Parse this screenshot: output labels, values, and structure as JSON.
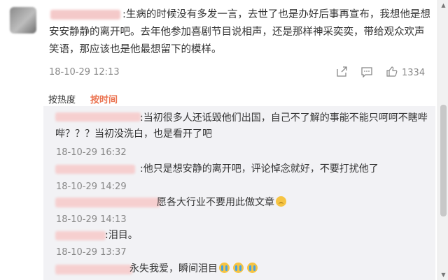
{
  "comment": {
    "text": ":生病的时候没有多发一言，去世了也是办好后事再宣布，我想他是想安安静静的离开吧。去年他参加喜剧节目说相声，还是那样神采奕奕，带给观众欢声笑语，那应该也是他最想留下的模样。",
    "time": "18-10-29 12:13",
    "like_count": "1334"
  },
  "sort": {
    "hot": "按热度",
    "time": "按时间"
  },
  "replies": [
    {
      "text": ":当初很多人还诋毁他们出国，自己不了解的事能不能只呵呵不瞎哔哔？？？当初没洗白，也是看开了吧",
      "time": "18-10-29 16:32"
    },
    {
      "text": ":他只是想安静的离开吧，评论悼念就好，不要打扰他了",
      "time": "18-10-29 14:29"
    },
    {
      "text": "愿各大行业不要用此做文章",
      "time": "18-10-29 14:13"
    },
    {
      "text": ":泪目。",
      "time": "18-10-29 13:37"
    },
    {
      "text": "永失我爱，瞬间泪目",
      "time": ""
    }
  ],
  "icons": [
    "share-icon",
    "comment-icon",
    "like-icon"
  ],
  "colors": {
    "accent": "#eb7350",
    "reply_bg": "#f2f2f5",
    "meta": "#888888"
  }
}
